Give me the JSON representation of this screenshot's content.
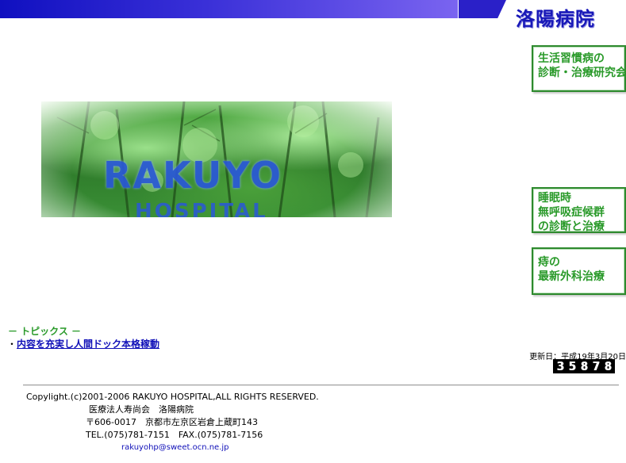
{
  "header": {
    "logo_text": "洛陽病院",
    "bar_color": "#2a20c8"
  },
  "banners": [
    {
      "lines": [
        "生活習慣病の",
        "診断・治療研究会"
      ]
    },
    {
      "lines": [
        "睡眠時",
        "無呼吸症候群",
        "の診断と治療"
      ]
    },
    {
      "lines": [
        "痔の",
        "最新外科治療"
      ]
    }
  ],
  "hero": {
    "title": "RAKUYO",
    "subtitle": "HOSPITAL"
  },
  "topics": {
    "heading": "－ トピックス －",
    "bullet": "・",
    "items": [
      {
        "label": "内容を充実し人間ドック本格稼動"
      }
    ]
  },
  "updated": "更新日：平成19年3月20日",
  "counter": {
    "digits": [
      "3",
      "5",
      "8",
      "7",
      "8"
    ]
  },
  "footer": {
    "copyright": "Copylight.(c)2001-2006 RAKUYO HOSPITAL,ALL RIGHTS RESERVED.",
    "org": "医療法人寿尚会　洛陽病院",
    "address": "〒606-0017　京都市左京区岩倉上蔵町143",
    "tel": "TEL.(075)781-7151　FAX.(075)781-7156",
    "email": "rakuyohp@sweet.ocn.ne.jp"
  }
}
